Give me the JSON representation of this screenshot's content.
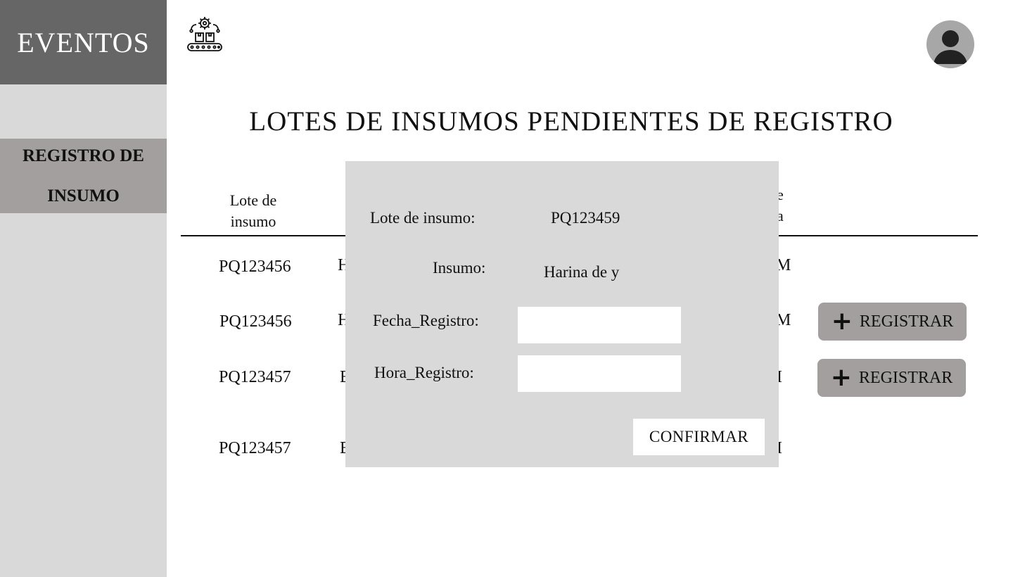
{
  "sidebar": {
    "brand": "EVENTOS",
    "items": [
      {
        "label_line1": "REGISTRO DE",
        "label_line2": "INSUMO"
      }
    ]
  },
  "page": {
    "title": "LOTES DE INSUMOS PENDIENTES DE REGISTRO"
  },
  "table": {
    "headers": [
      {
        "line1": "Lote de",
        "line2": "insumo"
      },
      {
        "line1": "e",
        "line2": "a"
      }
    ],
    "rows": [
      {
        "lote": "PQ123456",
        "insumo_fragment": "H",
        "fecha_fragment": "M",
        "action": null
      },
      {
        "lote": "PQ123456",
        "insumo_fragment": "H",
        "fecha_fragment": "M",
        "action": "REGISTRAR"
      },
      {
        "lote": "PQ123457",
        "insumo_fragment": "E",
        "fecha_fragment": "I",
        "action": "REGISTRAR"
      },
      {
        "lote": "PQ123457",
        "insumo_fragment": "E",
        "fecha_fragment": "I",
        "action": null
      }
    ]
  },
  "modal": {
    "lote_label": "Lote de insumo:",
    "lote_value": "PQ123459",
    "insumo_label": "Insumo:",
    "insumo_value": "Harina de y",
    "fecha_label": "Fecha_Registro:",
    "fecha_value": "",
    "hora_label": "Hora_Registro:",
    "hora_value": "",
    "confirm_label": "CONFIRMAR"
  },
  "icons": {
    "logo": "conveyor-gear-icon",
    "avatar": "user-avatar-icon",
    "add": "plus-icon"
  },
  "colors": {
    "sidebar_bg": "#d9d9d9",
    "brand_bg": "#666666",
    "nav_active": "#a39f9f",
    "button_bg": "#a39f9f",
    "modal_bg": "#d9d9d9"
  }
}
